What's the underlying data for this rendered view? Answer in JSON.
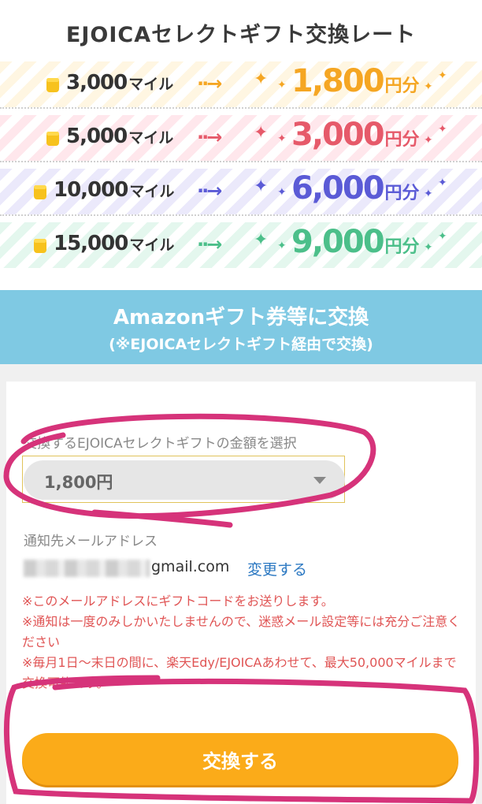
{
  "rate_title": "EJOICAセレクトギフト交換レート",
  "rates": [
    {
      "miles": "3,000",
      "mile_unit": "マイル",
      "arrow": "··→",
      "yen": "1,800",
      "yen_unit": "円分",
      "color": "#f5a623",
      "star_color": "#f5a623"
    },
    {
      "miles": "5,000",
      "mile_unit": "マイル",
      "arrow": "··→",
      "yen": "3,000",
      "yen_unit": "円分",
      "color": "#e65a6a",
      "star_color": "#e65a6a"
    },
    {
      "miles": "10,000",
      "mile_unit": "マイル",
      "arrow": "··→",
      "yen": "6,000",
      "yen_unit": "円分",
      "color": "#5b5bd6",
      "star_color": "#5b5bd6"
    },
    {
      "miles": "15,000",
      "mile_unit": "マイル",
      "arrow": "··→",
      "yen": "9,000",
      "yen_unit": "円分",
      "color": "#4cbf8a",
      "star_color": "#4cbf8a"
    }
  ],
  "amazon": {
    "title": "Amazonギフト券等に交換",
    "subtitle": "(※EJOICAセレクトギフト経由で交換)"
  },
  "form": {
    "select_label": "交換するEJOICAセレクトギフトの金額を選択",
    "selected_value": "1,800円",
    "notify_label": "通知先メールアドレス",
    "email_visible": "gmail.com",
    "change_link": "変更する",
    "notes": [
      "※このメールアドレスにギフトコードをお送りします。",
      "※通知は一度のみしかいたしませんので、迷惑メール設定等には充分ご注意ください",
      "※毎月1日〜末日の間に、楽天Edy/EJOICAあわせて、最大50,000マイルまで交換可能です。"
    ],
    "submit_label": "交換する"
  },
  "colors": {
    "banner": "#7fc9e3",
    "button": "#fbab19",
    "note_text": "#e05555",
    "link": "#2b78c2",
    "annotation": "#d6337a"
  }
}
